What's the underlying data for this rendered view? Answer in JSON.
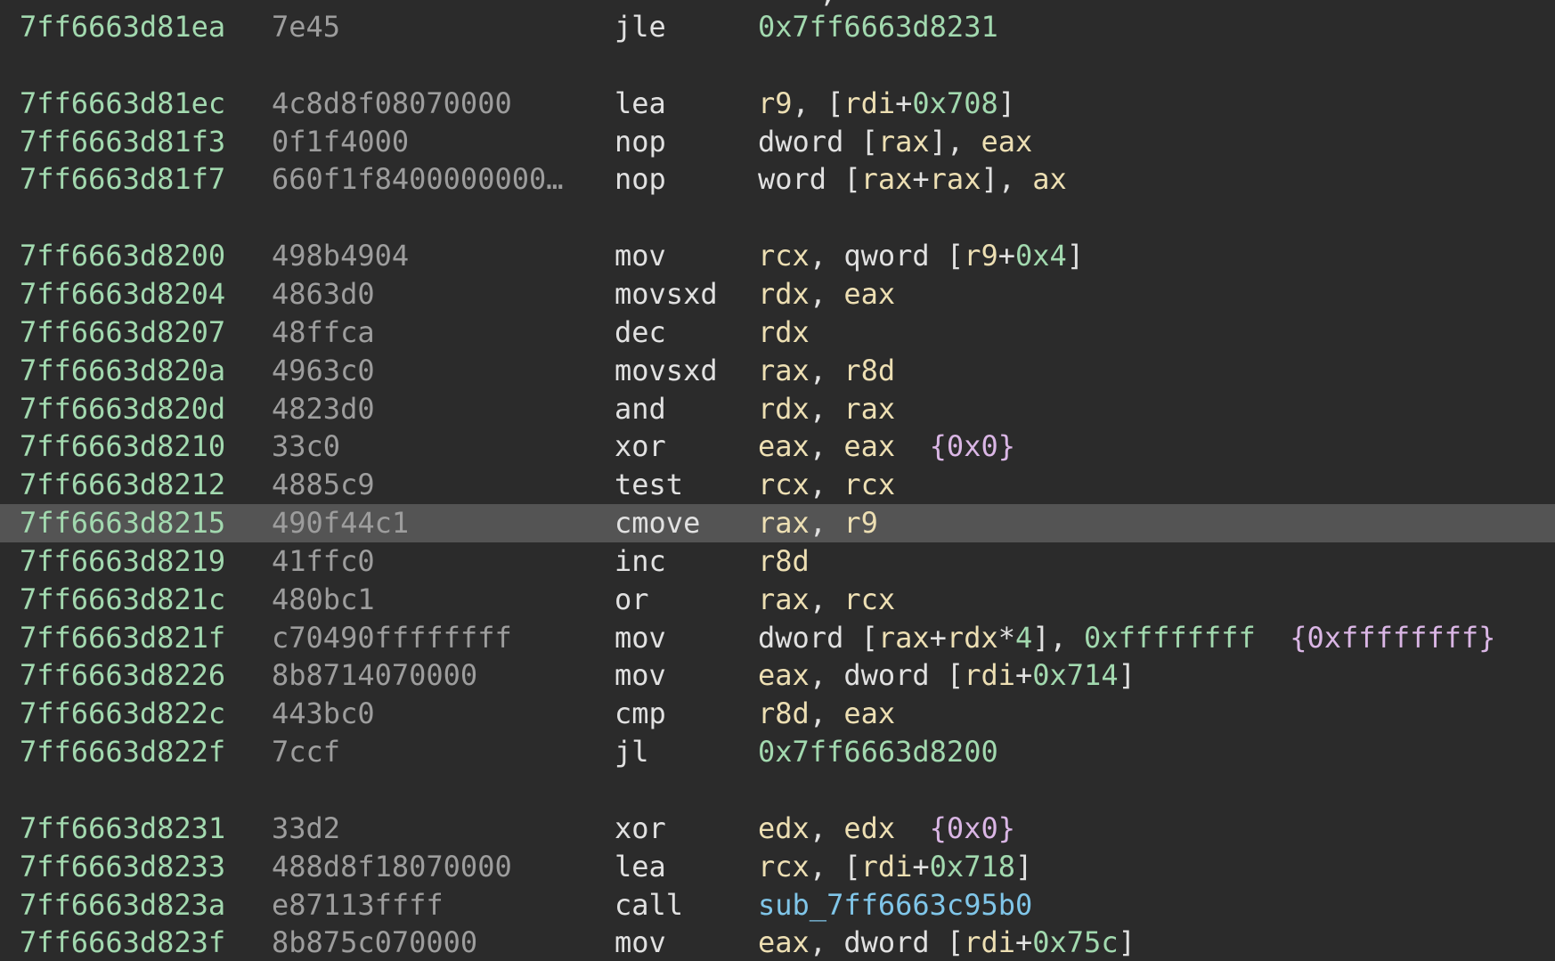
{
  "partial_top_char": ",",
  "rows": [
    {
      "addr": "7ff6663d81ea",
      "bytes": "7e45",
      "mnem": "jle",
      "ops": [
        [
          "num",
          "0x7ff6663d8231"
        ]
      ]
    },
    null,
    {
      "addr": "7ff6663d81ec",
      "bytes": "4c8d8f08070000",
      "mnem": "lea",
      "ops": [
        [
          "reg",
          "r9"
        ],
        [
          "pun",
          ", ["
        ],
        [
          "reg",
          "rdi"
        ],
        [
          "pun",
          "+"
        ],
        [
          "num",
          "0x708"
        ],
        [
          "pun",
          "]"
        ]
      ]
    },
    {
      "addr": "7ff6663d81f3",
      "bytes": "0f1f4000",
      "mnem": "nop",
      "ops": [
        [
          "txt",
          "dword ["
        ],
        [
          "reg",
          "rax"
        ],
        [
          "pun",
          "], "
        ],
        [
          "reg",
          "eax"
        ]
      ]
    },
    {
      "addr": "7ff6663d81f7",
      "bytes": "660f1f8400000000…",
      "mnem": "nop",
      "ops": [
        [
          "txt",
          "word ["
        ],
        [
          "reg",
          "rax"
        ],
        [
          "pun",
          "+"
        ],
        [
          "reg",
          "rax"
        ],
        [
          "pun",
          "], "
        ],
        [
          "reg",
          "ax"
        ]
      ]
    },
    null,
    {
      "addr": "7ff6663d8200",
      "bytes": "498b4904",
      "mnem": "mov",
      "ops": [
        [
          "reg",
          "rcx"
        ],
        [
          "pun",
          ", "
        ],
        [
          "txt",
          "qword ["
        ],
        [
          "reg",
          "r9"
        ],
        [
          "pun",
          "+"
        ],
        [
          "num",
          "0x4"
        ],
        [
          "pun",
          "]"
        ]
      ]
    },
    {
      "addr": "7ff6663d8204",
      "bytes": "4863d0",
      "mnem": "movsxd",
      "ops": [
        [
          "reg",
          "rdx"
        ],
        [
          "pun",
          ", "
        ],
        [
          "reg",
          "eax"
        ]
      ]
    },
    {
      "addr": "7ff6663d8207",
      "bytes": "48ffca",
      "mnem": "dec",
      "ops": [
        [
          "reg",
          "rdx"
        ]
      ]
    },
    {
      "addr": "7ff6663d820a",
      "bytes": "4963c0",
      "mnem": "movsxd",
      "ops": [
        [
          "reg",
          "rax"
        ],
        [
          "pun",
          ", "
        ],
        [
          "reg",
          "r8d"
        ]
      ]
    },
    {
      "addr": "7ff6663d820d",
      "bytes": "4823d0",
      "mnem": "and",
      "ops": [
        [
          "reg",
          "rdx"
        ],
        [
          "pun",
          ", "
        ],
        [
          "reg",
          "rax"
        ]
      ]
    },
    {
      "addr": "7ff6663d8210",
      "bytes": "33c0",
      "mnem": "xor",
      "ops": [
        [
          "reg",
          "eax"
        ],
        [
          "pun",
          ", "
        ],
        [
          "reg",
          "eax"
        ],
        [
          "pun",
          "  "
        ],
        [
          "ann",
          "{0x0}"
        ]
      ]
    },
    {
      "addr": "7ff6663d8212",
      "bytes": "4885c9",
      "mnem": "test",
      "ops": [
        [
          "reg",
          "rcx"
        ],
        [
          "pun",
          ", "
        ],
        [
          "reg",
          "rcx"
        ]
      ]
    },
    {
      "addr": "7ff6663d8215",
      "bytes": "490f44c1",
      "mnem": "cmove",
      "ops": [
        [
          "reg",
          "rax"
        ],
        [
          "pun",
          ", "
        ],
        [
          "reg",
          "r9"
        ]
      ],
      "highlight": true
    },
    {
      "addr": "7ff6663d8219",
      "bytes": "41ffc0",
      "mnem": "inc",
      "ops": [
        [
          "reg",
          "r8d"
        ]
      ]
    },
    {
      "addr": "7ff6663d821c",
      "bytes": "480bc1",
      "mnem": "or",
      "ops": [
        [
          "reg",
          "rax"
        ],
        [
          "pun",
          ", "
        ],
        [
          "reg",
          "rcx"
        ]
      ]
    },
    {
      "addr": "7ff6663d821f",
      "bytes": "c70490ffffffff",
      "mnem": "mov",
      "ops": [
        [
          "txt",
          "dword ["
        ],
        [
          "reg",
          "rax"
        ],
        [
          "pun",
          "+"
        ],
        [
          "reg",
          "rdx"
        ],
        [
          "pun",
          "*"
        ],
        [
          "num",
          "4"
        ],
        [
          "pun",
          "], "
        ],
        [
          "num",
          "0xffffffff"
        ],
        [
          "pun",
          "  "
        ],
        [
          "ann",
          "{0xffffffff}"
        ]
      ]
    },
    {
      "addr": "7ff6663d8226",
      "bytes": "8b8714070000",
      "mnem": "mov",
      "ops": [
        [
          "reg",
          "eax"
        ],
        [
          "pun",
          ", "
        ],
        [
          "txt",
          "dword ["
        ],
        [
          "reg",
          "rdi"
        ],
        [
          "pun",
          "+"
        ],
        [
          "num",
          "0x714"
        ],
        [
          "pun",
          "]"
        ]
      ]
    },
    {
      "addr": "7ff6663d822c",
      "bytes": "443bc0",
      "mnem": "cmp",
      "ops": [
        [
          "reg",
          "r8d"
        ],
        [
          "pun",
          ", "
        ],
        [
          "reg",
          "eax"
        ]
      ]
    },
    {
      "addr": "7ff6663d822f",
      "bytes": "7ccf",
      "mnem": "jl",
      "ops": [
        [
          "num",
          "0x7ff6663d8200"
        ]
      ]
    },
    null,
    {
      "addr": "7ff6663d8231",
      "bytes": "33d2",
      "mnem": "xor",
      "ops": [
        [
          "reg",
          "edx"
        ],
        [
          "pun",
          ", "
        ],
        [
          "reg",
          "edx"
        ],
        [
          "pun",
          "  "
        ],
        [
          "ann",
          "{0x0}"
        ]
      ]
    },
    {
      "addr": "7ff6663d8233",
      "bytes": "488d8f18070000",
      "mnem": "lea",
      "ops": [
        [
          "reg",
          "rcx"
        ],
        [
          "pun",
          ", ["
        ],
        [
          "reg",
          "rdi"
        ],
        [
          "pun",
          "+"
        ],
        [
          "num",
          "0x718"
        ],
        [
          "pun",
          "]"
        ]
      ]
    },
    {
      "addr": "7ff6663d823a",
      "bytes": "e87113ffff",
      "mnem": "call",
      "ops": [
        [
          "sym",
          "sub_7ff6663c95b0"
        ]
      ]
    },
    {
      "addr": "7ff6663d823f",
      "bytes": "8b875c070000",
      "mnem": "mov",
      "ops": [
        [
          "reg",
          "eax"
        ],
        [
          "pun",
          ", "
        ],
        [
          "txt",
          "dword ["
        ],
        [
          "reg",
          "rdi"
        ],
        [
          "pun",
          "+"
        ],
        [
          "num",
          "0x75c"
        ],
        [
          "pun",
          "]"
        ]
      ]
    }
  ]
}
